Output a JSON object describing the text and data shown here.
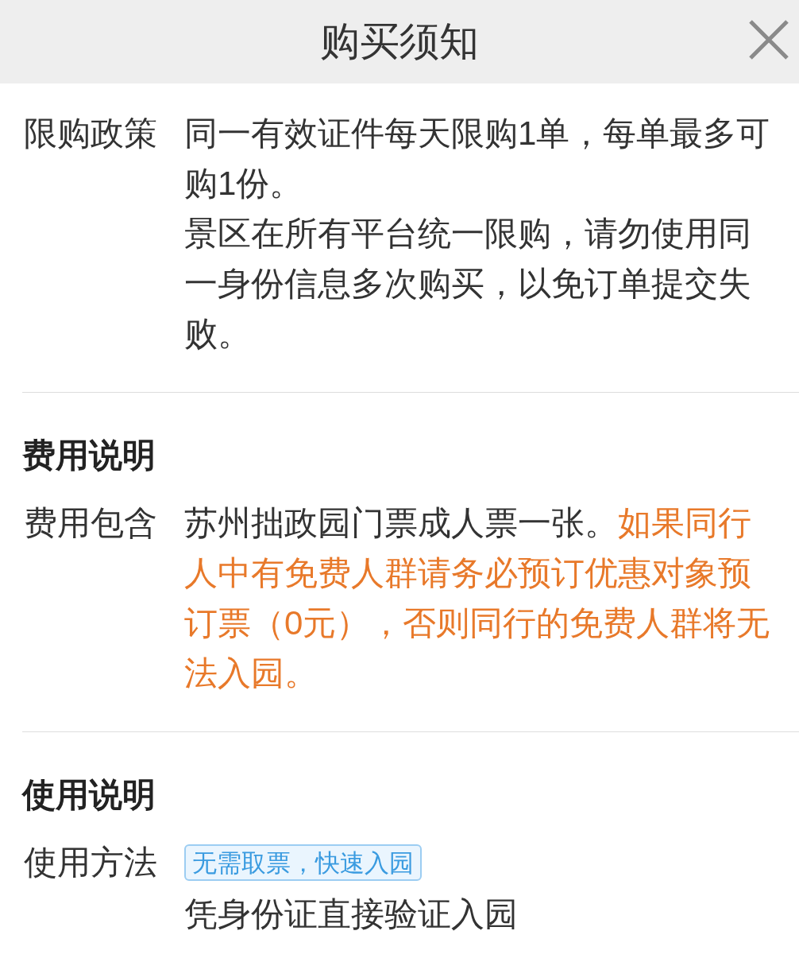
{
  "header": {
    "title": "购买须知"
  },
  "sections": [
    {
      "rows": [
        {
          "label": "限购政策",
          "paragraphs": [
            [
              {
                "text": "同一有效证件每天限购1单，每单最多可购1份。",
                "highlight": false
              }
            ],
            [
              {
                "text": "景区在所有平台统一限购，请勿使用同一身份信息多次购买，以免订单提交失败。",
                "highlight": false
              }
            ]
          ]
        }
      ]
    },
    {
      "title": "费用说明",
      "rows": [
        {
          "label": "费用包含",
          "paragraphs": [
            [
              {
                "text": "苏州拙政园门票成人票一张。",
                "highlight": false
              },
              {
                "text": "如果同行人中有免费人群请务必预订优惠对象预订票（0元），否则同行的免费人群将无法入园。",
                "highlight": true
              }
            ]
          ]
        }
      ]
    },
    {
      "title": "使用说明",
      "rows": [
        {
          "label": "使用方法",
          "tag": "无需取票，快速入园",
          "paragraphs": [
            [
              {
                "text": "凭身份证直接验证入园",
                "highlight": false
              }
            ]
          ]
        }
      ]
    }
  ]
}
